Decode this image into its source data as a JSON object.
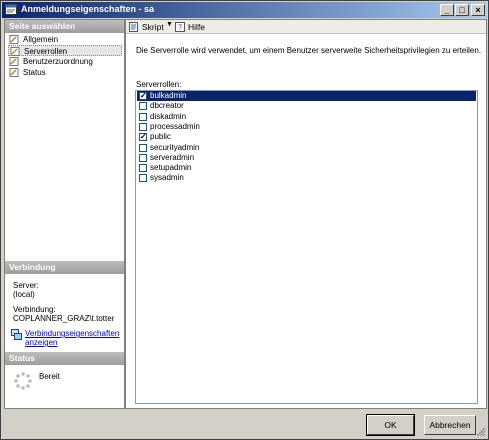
{
  "window": {
    "title": "Anmeldungseigenschaften - sa"
  },
  "titlebar_buttons": {
    "minimize": "_",
    "maximize": "□",
    "close": "×"
  },
  "sidebar": {
    "header": "Seite auswählen",
    "items": [
      {
        "label": "Allgemein"
      },
      {
        "label": "Serverrollen"
      },
      {
        "label": "Benutzerzuordnung"
      },
      {
        "label": "Status"
      }
    ],
    "selected_index": 1
  },
  "connection": {
    "header": "Verbindung",
    "server_label": "Server:",
    "server_value": "(local)",
    "connection_label": "Verbindung:",
    "connection_value": "COPLANNER_GRAZ\\t.totter",
    "link_line1": "Verbindungseigenschaften",
    "link_line2": "anzeigen"
  },
  "status": {
    "header": "Status",
    "text": "Bereit"
  },
  "toolbar": {
    "script_label": "Skript",
    "help_label": "Hilfe"
  },
  "main": {
    "description": "Die Serverrolle wird verwendet, um einem Benutzer serverweite Sicherheitsprivilegien zu erteilen.",
    "list_label": "Serverrollen:",
    "roles": [
      {
        "name": "bulkadmin",
        "checked": true,
        "selected": true
      },
      {
        "name": "dbcreator",
        "checked": false,
        "selected": false
      },
      {
        "name": "diskadmin",
        "checked": false,
        "selected": false
      },
      {
        "name": "processadmin",
        "checked": false,
        "selected": false
      },
      {
        "name": "public",
        "checked": true,
        "selected": false
      },
      {
        "name": "securityadmin",
        "checked": false,
        "selected": false
      },
      {
        "name": "serveradmin",
        "checked": false,
        "selected": false
      },
      {
        "name": "setupadmin",
        "checked": false,
        "selected": false
      },
      {
        "name": "sysadmin",
        "checked": false,
        "selected": false
      }
    ]
  },
  "buttons": {
    "ok": "OK",
    "cancel": "Abbrechen"
  }
}
